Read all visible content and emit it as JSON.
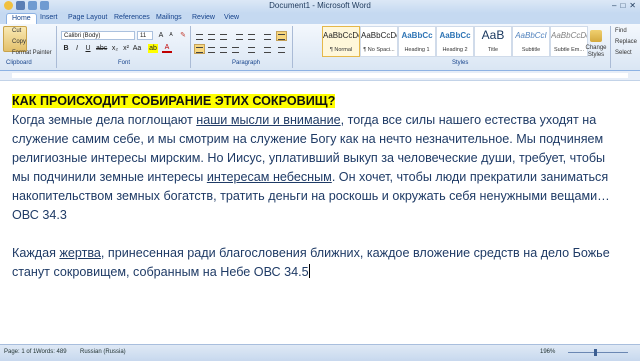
{
  "window": {
    "title": "Document1 - Microsoft Word",
    "controls": [
      "–",
      "□",
      "✕"
    ]
  },
  "tabs": [
    "Home",
    "Insert",
    "Page Layout",
    "References",
    "Mailings",
    "Review",
    "View"
  ],
  "ribbon": {
    "clipboard": {
      "cut": "Cut",
      "copy": "Copy",
      "format_painter": "Format Painter",
      "label": "Clipboard"
    },
    "font": {
      "family": "Calibri (Body)",
      "size": "11",
      "label": "Font"
    },
    "paragraph": {
      "label": "Paragraph"
    },
    "styles": {
      "items": [
        {
          "sample": "AaBbCcDc",
          "name": "¶ Normal"
        },
        {
          "sample": "AaBbCcDc",
          "name": "¶ No Spaci..."
        },
        {
          "sample": "AaBbCc",
          "name": "Heading 1"
        },
        {
          "sample": "AaBbCc",
          "name": "Heading 2"
        },
        {
          "sample": "AaB",
          "name": "Title"
        },
        {
          "sample": "AaBbCcI",
          "name": "Subtitle"
        },
        {
          "sample": "AaBbCcDc",
          "name": "Subtle Em..."
        }
      ],
      "change_styles": "Change Styles",
      "label": "Styles"
    },
    "editing": {
      "find": "Find",
      "replace": "Replace",
      "select": "Select"
    }
  },
  "document": {
    "heading": "КАК ПРОИСХОДИТ СОБИРАНИЕ ЭТИХ СОКРОВИЩ?",
    "p1": {
      "l1a": "Когда земные дела поглощают ",
      "l1u": "наши мысли и внимание",
      "l1b": ", тогда все силы нашего естества уходят на",
      "l2": "служение самим себе, и мы смотрим на служение Богу как на нечто незначительное. Мы подчиняем",
      "l3": "религиозные интересы мирским. Но Иисус, уплативший выкуп за человеческие души, требует, чтобы",
      "l4a": "мы подчинили земные интересы ",
      "l4u": "интересам небесным",
      "l4b": ". Он хочет, чтобы люди прекратили заниматься",
      "l5": "накопительством земных богатств, тратить деньги на роскошь и окружать себя ненужными вещами…",
      "l6": "ОВС 34.3"
    },
    "p2": {
      "l1a": "Каждая ",
      "l1u": "жертва",
      "l1b": ", принесенная ради благословения ближних, каждое вложение средств на дело Божье",
      "l2": "станут сокровищем, собранным на Небе ОВС 34.5"
    }
  },
  "status": {
    "page": "Page: 1 of 1",
    "words": "Words: 489",
    "language": "Russian (Russia)",
    "zoom": "196%"
  }
}
